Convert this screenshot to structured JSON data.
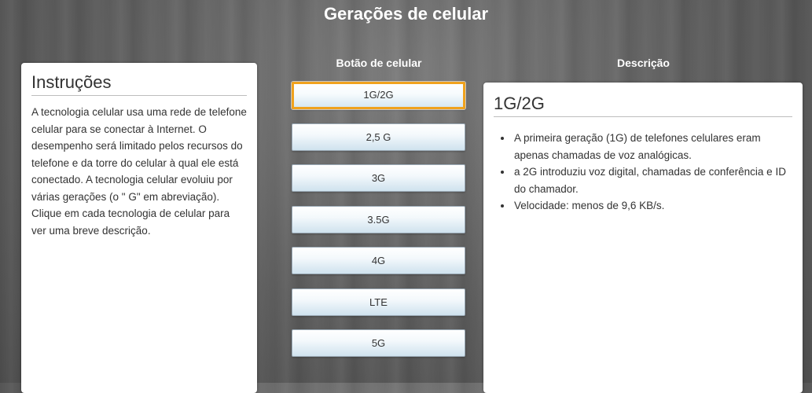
{
  "page": {
    "title": "Gerações de celular"
  },
  "columns": {
    "buttons_heading": "Botão de celular",
    "description_heading": "Descrição"
  },
  "instructions": {
    "title": "Instruções",
    "text": "A tecnologia celular usa uma rede de telefone celular para se conectar à Internet. O desempenho será limitado pelos recursos do telefone e da torre do celular à qual ele está conectado. A tecnologia celular evoluiu por várias gerações (o \" G\"  em abreviação). Clique em cada tecnologia de celular para ver uma breve descrição."
  },
  "buttons": [
    {
      "label": "1G/2G",
      "selected": true
    },
    {
      "label": "2,5 G",
      "selected": false
    },
    {
      "label": "3G",
      "selected": false
    },
    {
      "label": "3.5G",
      "selected": false
    },
    {
      "label": "4G",
      "selected": false
    },
    {
      "label": "LTE",
      "selected": false
    },
    {
      "label": "5G",
      "selected": false
    }
  ],
  "description": {
    "title": "1G/2G",
    "items": [
      "A primeira geração (1G) de telefones celulares eram apenas chamadas de voz analógicas.",
      "a 2G introduziu voz digital, chamadas de conferência e ID do chamador.",
      "Velocidade: menos de 9,6 KB/s."
    ]
  },
  "colors": {
    "selected_border": "#f0a21d",
    "panel_background": "#ffffff",
    "text": "#333333"
  }
}
